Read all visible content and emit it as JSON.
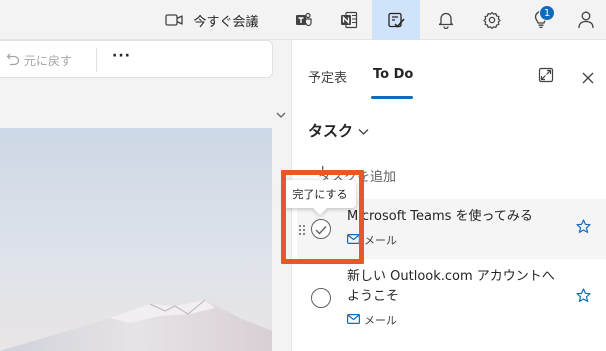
{
  "topbar": {
    "meet_now_label": "今すぐ会議",
    "notification_badge": "1",
    "icons": [
      "video-camera-icon",
      "teams-icon",
      "onenote-icon",
      "todo-icon",
      "bell-icon",
      "gear-icon",
      "lightbulb-icon",
      "person-icon"
    ]
  },
  "toolbar": {
    "undo_label": "元に戻す",
    "more_label": "···"
  },
  "todo_panel": {
    "tab_calendar": "予定表",
    "tab_todo": "To Do",
    "section_title": "タスク",
    "add_task_placeholder": "タスクを追加",
    "tooltip": "完了にする",
    "tasks": [
      {
        "title": "Microsoft Teams を使ってみる",
        "source": "メール"
      },
      {
        "title": "新しい Outlook.com アカウントへようこそ",
        "source": "メール"
      }
    ]
  },
  "colors": {
    "accent": "#0f6cbd",
    "selected_tab_bg": "#cfe4fa",
    "annotation_box": "#e8562a"
  }
}
